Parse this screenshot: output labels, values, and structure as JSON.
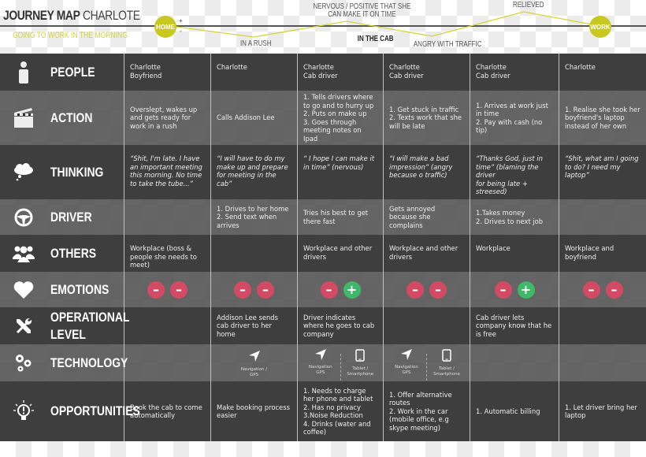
{
  "header": {
    "title_bold": "JOURNEY MAP",
    "title_light": "CHARLOTE",
    "subtitle": "GOING TO WORK IN THE MORNING",
    "start_node": "HOME",
    "end_node": "WORK",
    "plus": "+",
    "minus": "-",
    "mood_labels": {
      "in_a_rush": "IN A RUSH",
      "nervous": "NERVOUS / POSITIVE THAT SHE\nCAN MAKE IT ON TIME",
      "in_the_cab": "IN THE CAB",
      "angry": "ANGRY WITH TRAFFIC",
      "relieved": "RELIEVED"
    },
    "accent_color": "#c8c81e"
  },
  "rows": [
    {
      "label": "PEOPLE",
      "icon": "person-icon",
      "cells": [
        "Charlotte\nBoyfriend",
        "Charlotte",
        "Charlotte\nCab driver",
        "Charlotte\nCab driver",
        "Charlotte\nCab driver",
        "Charlotte"
      ]
    },
    {
      "label": "ACTION",
      "icon": "clapperboard-icon",
      "cells": [
        "Overslept, wakes up and gets ready for work in a rush",
        "Calls Addison Lee",
        "1. Tells drivers where to go and to hurry up\n2. Puts on make up\n3. Goes through meeting notes on Ipad",
        "1. Get stuck in traffic\n2. Texts work that she will be late",
        "1. Arrives at work just in time\n2. Pay with cash (no tip)",
        "1. Realise she took her boyfriend's laptop instead of her own"
      ]
    },
    {
      "label": "THINKING",
      "icon": "thought-cloud-icon",
      "cells": [
        "“Shit, I'm late. I have an important meeting this morning. No time to take the tube...”",
        "“I will have to do my make up and prepare for meeting in the cab”",
        "“ I hope I can make it in time” (nervous)",
        "“I will make a bad impression” (angry because o traffic)",
        "“Thanks God, just in time” (blaming the driver\nfor being late +  streesed)",
        "“Shit, what am I going to do? I need my laptop”"
      ]
    },
    {
      "label": "DRIVER",
      "icon": "steering-wheel-icon",
      "cells": [
        "",
        "1. Drives to her home\n2. Send text when arrives",
        "Tries his best to get there fast",
        "Gets annoyed because she complains",
        "1.Takes money\n2. Drives to next job",
        ""
      ]
    },
    {
      "label": "OTHERS",
      "icon": "group-icon",
      "cells": [
        "Workplace (boss & people she needs to meet)",
        "",
        "Workplace and other drivers",
        "Workplace and other drivers",
        "Workplace",
        "Workplace and boyfriend"
      ]
    },
    {
      "label": "EMOTIONS",
      "icon": "heart-icon",
      "emotions": [
        [
          "neg",
          "neg"
        ],
        [
          "neg",
          "neg"
        ],
        [
          "neg",
          "pos"
        ],
        [
          "neg",
          "neg"
        ],
        [
          "neg",
          "pos"
        ],
        [
          "neg",
          "neg"
        ]
      ],
      "emotion_symbols": {
        "neg": "–",
        "pos": "+"
      }
    },
    {
      "label": "OPERATIONAL\nLEVEL",
      "icon": "tools-icon",
      "cells": [
        "",
        "Addison Lee sends cab driver to her home",
        "Driver indicates where he goes to cab company",
        "",
        "Cab driver lets company know that he is free",
        ""
      ]
    },
    {
      "label": "TECHNOLOGY",
      "icon": "gears-icon",
      "tech": [
        [],
        [
          {
            "icon": "navigation-icon",
            "label": "Navigation / GPS"
          }
        ],
        [
          {
            "icon": "navigation-icon",
            "label": "Navigation\nGPS"
          },
          {
            "icon": "tablet-icon",
            "label": "Tablet /\nSmartphone"
          }
        ],
        [
          {
            "icon": "navigation-icon",
            "label": "Navigation\nGPS"
          },
          {
            "icon": "tablet-icon",
            "label": "Tablet /\nSmartphone"
          }
        ],
        [],
        []
      ]
    },
    {
      "label": "OPPORTUNITIES",
      "icon": "lightbulb-icon",
      "cells": [
        "Book the cab to come automatically",
        "Make booking process easier",
        "1. Needs to charge her phone and tablet\n2. Has no privacy\n3.Noise Reduction\n4. Drinks (water and coffee)",
        "1. Offer alternative routes\n2. Work in the car (mobile office, e.g skype meeting)",
        "1. Automatic billing",
        "1. Let driver bring her laptop"
      ]
    }
  ],
  "colors": {
    "negative": "#d24a64",
    "positive": "#3fb86a",
    "row_dark": "#3e3e3e",
    "row_light": "#5a5a5a"
  }
}
